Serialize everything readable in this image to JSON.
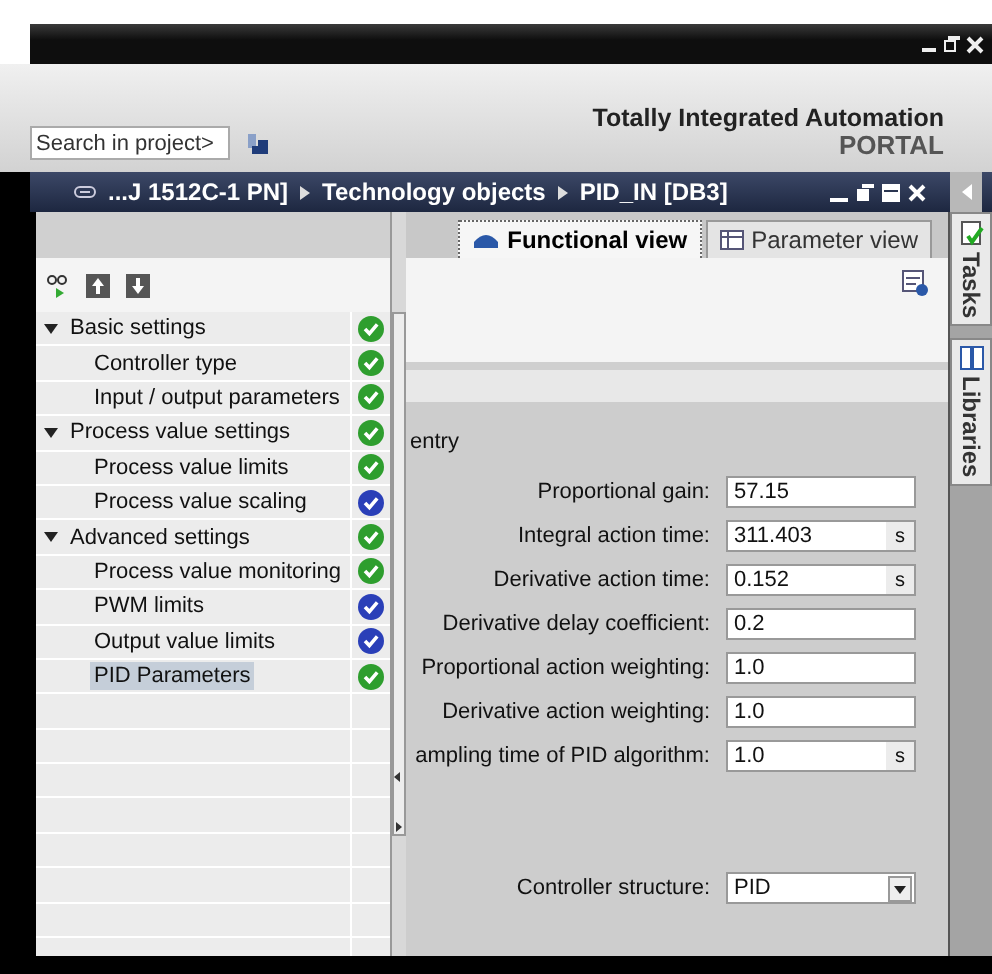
{
  "header": {
    "search": {
      "placeholder": "Search in project>"
    },
    "title": "Totally Integrated Automation",
    "subtitle": "PORTAL"
  },
  "breadcrumb": [
    "...J 1512C-1 PN]",
    "Technology objects",
    "PID_IN [DB3]"
  ],
  "tabs": [
    {
      "label": "Functional view",
      "selected": true
    },
    {
      "label": "Parameter view",
      "selected": false
    }
  ],
  "tree": [
    {
      "label": "Basic settings",
      "color": "#2e9e2e",
      "selected": false,
      "expanded": true,
      "children": [
        {
          "label": "Controller type",
          "color": "#2e9e2e",
          "selected": false
        },
        {
          "label": "Input / output parameters",
          "color": "#2e9e2e",
          "selected": false
        }
      ]
    },
    {
      "label": "Process value settings",
      "color": "#2e9e2e",
      "selected": false,
      "expanded": true,
      "children": [
        {
          "label": "Process value limits",
          "color": "#2e9e2e",
          "selected": false
        },
        {
          "label": "Process value scaling",
          "color": "#2a3fb8",
          "selected": false
        }
      ]
    },
    {
      "label": "Advanced settings",
      "color": "#2e9e2e",
      "selected": false,
      "expanded": true,
      "children": [
        {
          "label": "Process value monitoring",
          "color": "#2e9e2e",
          "selected": false
        },
        {
          "label": "PWM limits",
          "color": "#2a3fb8",
          "selected": false
        },
        {
          "label": "Output value limits",
          "color": "#2a3fb8",
          "selected": false
        },
        {
          "label": "PID Parameters",
          "color": "#2e9e2e",
          "selected": true
        }
      ]
    }
  ],
  "section_heading": "entry",
  "fields": [
    {
      "kind": "input",
      "label": "Proportional gain:",
      "value": "57.15"
    },
    {
      "kind": "input",
      "label": "Integral action time:",
      "value": "311.403",
      "unit": "s"
    },
    {
      "kind": "input",
      "label": "Derivative action time:",
      "value": "0.152",
      "unit": "s"
    },
    {
      "kind": "input",
      "label": "Derivative delay coefficient:",
      "value": "0.2"
    },
    {
      "kind": "input",
      "label": "Proportional action weighting:",
      "value": "1.0"
    },
    {
      "kind": "input",
      "label": "Derivative action weighting:",
      "value": "1.0"
    },
    {
      "kind": "input",
      "label": "ampling time of PID algorithm:",
      "value": "1.0",
      "unit": "s"
    },
    {
      "kind": "dropdown",
      "label": "Controller structure:",
      "value": "PID"
    }
  ],
  "side_tabs": [
    "Tasks",
    "Libraries"
  ]
}
